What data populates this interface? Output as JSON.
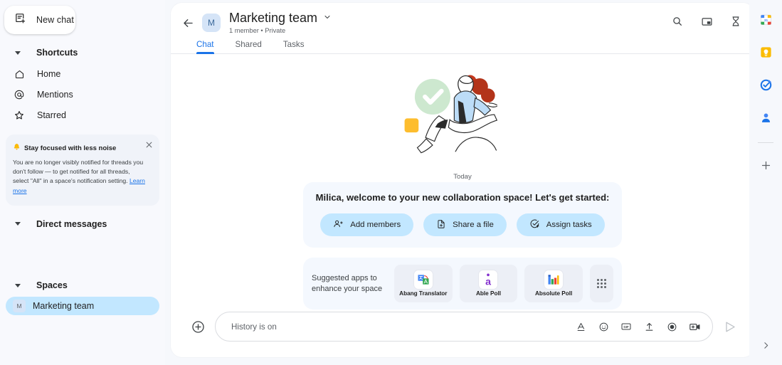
{
  "sidebar": {
    "new_chat": {
      "label": "New chat",
      "icon": "new-chat-icon"
    },
    "sections": {
      "shortcuts": {
        "title": "Shortcuts",
        "items": [
          {
            "label": "Home",
            "icon": "home-icon"
          },
          {
            "label": "Mentions",
            "icon": "at-mention-icon"
          },
          {
            "label": "Starred",
            "icon": "star-icon"
          }
        ]
      },
      "direct_messages": {
        "title": "Direct messages"
      },
      "spaces": {
        "title": "Spaces",
        "items": [
          {
            "label": "Marketing team",
            "avatar_letter": "M",
            "selected": true
          }
        ]
      }
    },
    "notification": {
      "icon": "bell-icon",
      "title": "Stay focused with less noise",
      "body": "You are no longer visibly notified for threads you don't follow — to get notified for all threads, select \"All\" in a space's notification setting. ",
      "link": "Learn more",
      "close_icon": "close-icon"
    }
  },
  "header": {
    "back_icon": "back-arrow-icon",
    "avatar_letter": "M",
    "title": "Marketing team",
    "dropdown_icon": "chevron-down-icon",
    "subtitle": "1 member • Private",
    "actions": [
      {
        "name": "search-icon"
      },
      {
        "name": "picture-in-picture-icon"
      },
      {
        "name": "hourglass-icon"
      }
    ],
    "tabs": [
      {
        "label": "Chat",
        "active": true
      },
      {
        "label": "Shared",
        "active": false
      },
      {
        "label": "Tasks",
        "active": false
      }
    ]
  },
  "conversation": {
    "day_divider": "Today",
    "welcome_text": "Milica, welcome to your new collaboration space! Let's get started:",
    "actions": [
      {
        "label": "Add members",
        "icon": "add-members-icon"
      },
      {
        "label": "Share a file",
        "icon": "share-file-icon"
      },
      {
        "label": "Assign tasks",
        "icon": "assign-tasks-icon"
      }
    ],
    "apps": {
      "label_line1": "Suggested apps to",
      "label_line2": "enhance your space",
      "items": [
        {
          "name": "Abang Translator",
          "icon": "abang-translator-icon"
        },
        {
          "name": "Able Poll",
          "icon": "able-poll-icon"
        },
        {
          "name": "Absolute Poll",
          "icon": "absolute-poll-icon"
        }
      ],
      "more_icon": "apps-grid-icon"
    }
  },
  "composer": {
    "plus_icon": "add-attachment-icon",
    "placeholder": "History is on",
    "value": "",
    "icons": [
      {
        "name": "text-format-icon"
      },
      {
        "name": "emoji-icon"
      },
      {
        "name": "gif-icon"
      },
      {
        "name": "upload-file-icon"
      },
      {
        "name": "record-icon"
      },
      {
        "name": "video-message-icon"
      }
    ],
    "send_icon": "send-icon"
  },
  "right_rail": {
    "items": [
      {
        "name": "google-calendar-icon"
      },
      {
        "name": "google-keep-icon"
      },
      {
        "name": "google-tasks-icon"
      },
      {
        "name": "google-contacts-icon"
      }
    ],
    "add_icon": "add-app-icon",
    "expand_icon": "chevron-right-icon"
  },
  "colors": {
    "accent": "#1a73e8",
    "chip_bg": "#c2e7ff",
    "sidebar_bg": "#f8f9fd",
    "card_bg": "#f4f8fe"
  }
}
